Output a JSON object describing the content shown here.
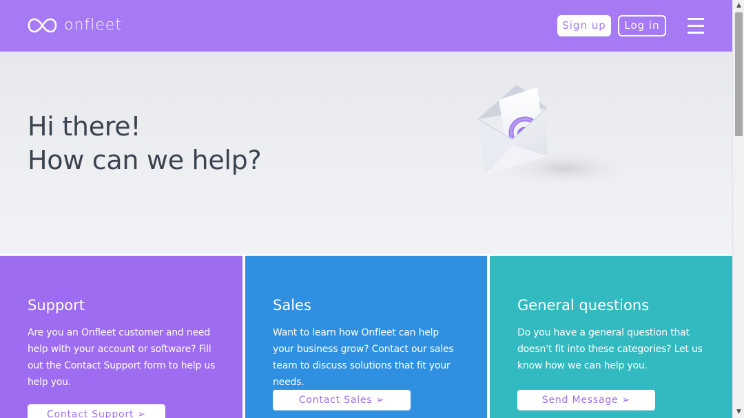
{
  "header": {
    "logo_text": "onfleet",
    "signup_label": "Sign up",
    "login_label": "Log in",
    "menu_icon": "hamburger-menu-icon"
  },
  "hero": {
    "title_line1": "Hi there!",
    "title_line2": "How can we help?",
    "illustration": "envelope-at-sign-icon"
  },
  "cards": [
    {
      "title": "Support",
      "description": "Are you an Onfleet customer and need help with your account or software? Fill out the Contact Support form to help us help you.",
      "button_label": "Contact Support ➢"
    },
    {
      "title": "Sales",
      "description": "Want to learn how Onfleet can help your business grow? Contact our sales team to discuss solutions that fit your needs.",
      "button_label": "Contact Sales ➢"
    },
    {
      "title": "General questions",
      "description": "Do you have a general question that doesn't fit into these categories? Let us know how we can help you.",
      "button_label": "Send Message ➢"
    }
  ],
  "colors": {
    "header": "#a67af4",
    "support": "#9e6cf0",
    "sales": "#2f8fe0",
    "general": "#33b9c0",
    "hero_text": "#3a4350"
  }
}
